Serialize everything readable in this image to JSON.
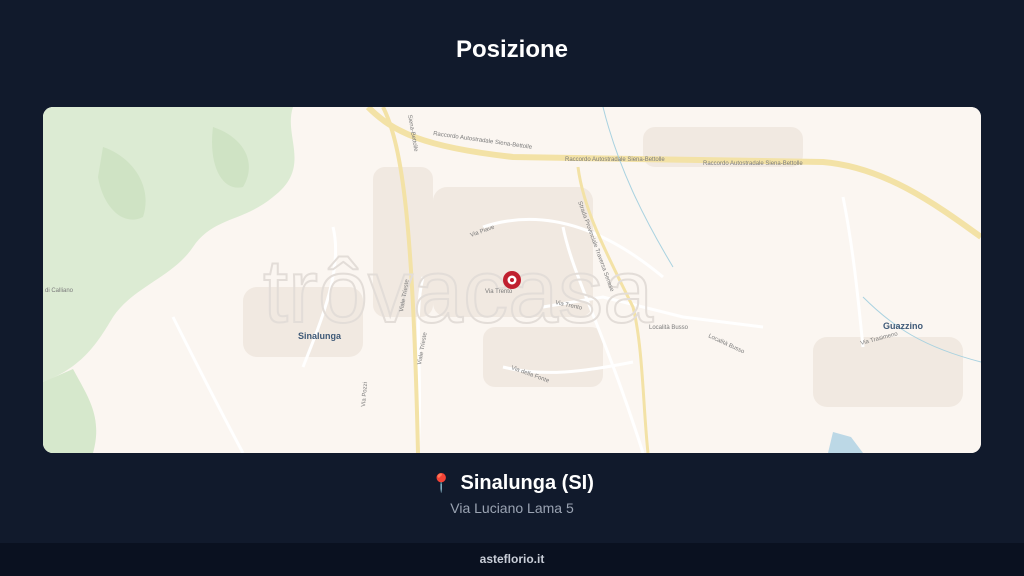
{
  "title": "Posizione",
  "map": {
    "watermark": "trôvacasa",
    "places": {
      "sinalunga": "Sinalunga",
      "guazzino": "Guazzino"
    },
    "roads": {
      "raccordo_1": "Raccordo Autostradale Siena-Bettolle",
      "raccordo_2": "Raccordo Autostradale Siena-Bettolle",
      "raccordo_3": "Raccordo Autostradale Siena-Bettolle",
      "raccordo_top": "Siena-Bettolle",
      "via_piave": "Via Piave",
      "via_trento": "Via Trento",
      "via_trento_2": "Via Trento",
      "viale_trieste": "Viale Trieste",
      "viale_trieste_2": "Viale Trieste",
      "localita_busso": "Località Busso",
      "localita_busso_2": "Località Busso",
      "via_trasimeno": "Via Trasimeno",
      "strada_provinciale": "Strada Provinciale Traversa Senese",
      "via_di_calliano": "di Calliano",
      "via_dei_pozzi": "Via Pozzi",
      "via_della_fonte": "Via della Fonte"
    },
    "marker_icon": "map-pin-icon"
  },
  "location": {
    "pin_icon": "📍",
    "city": "Sinalunga (SI)",
    "address": "Via Luciano Lama 5"
  },
  "footer": {
    "site": "asteflorio.it"
  },
  "colors": {
    "background": "#111a2c",
    "marker": "#c0202f",
    "highway": "#f3e2a6"
  }
}
